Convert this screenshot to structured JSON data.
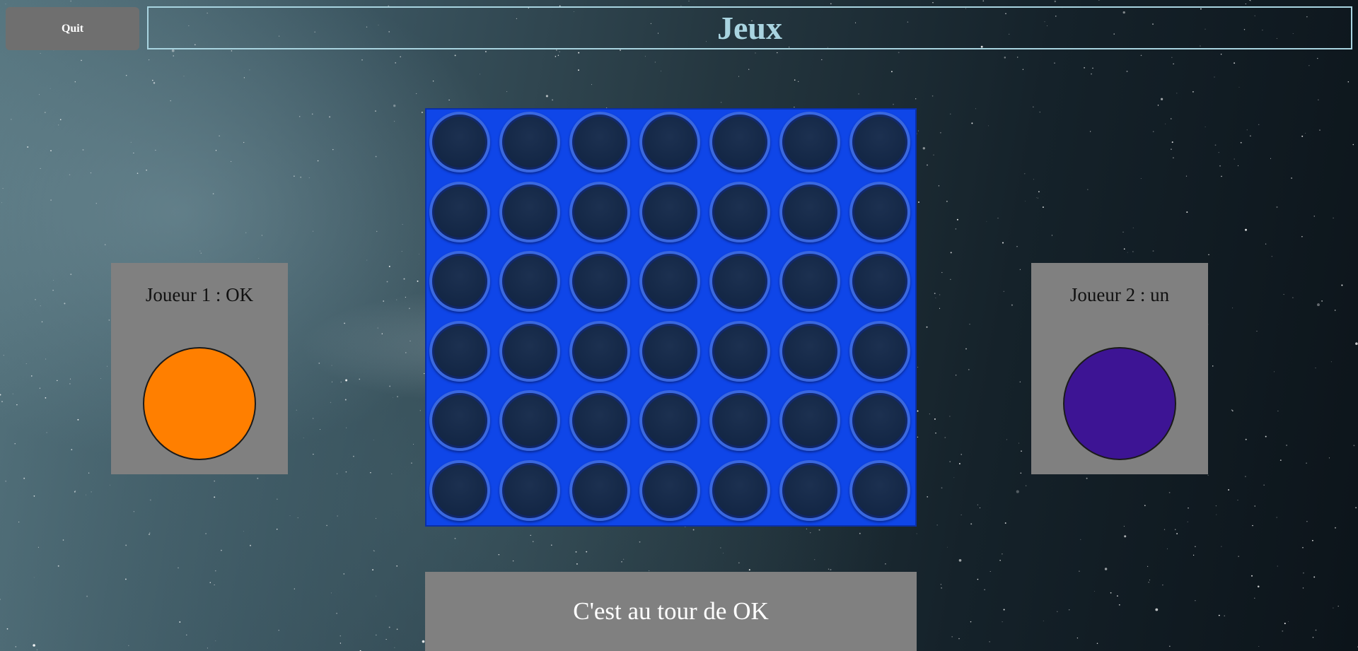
{
  "header": {
    "quit_label": "Quit",
    "title": "Jeux"
  },
  "players": [
    {
      "label": "Joueur 1 : OK",
      "color": "#ff7f00"
    },
    {
      "label": "Joueur 2 : un",
      "color": "#3d1494"
    }
  ],
  "board": {
    "columns": 7,
    "rows": 6,
    "color": "#0f46e8",
    "cells": [
      [
        "",
        "",
        "",
        "",
        "",
        "",
        ""
      ],
      [
        "",
        "",
        "",
        "",
        "",
        "",
        ""
      ],
      [
        "",
        "",
        "",
        "",
        "",
        "",
        ""
      ],
      [
        "",
        "",
        "",
        "",
        "",
        "",
        ""
      ],
      [
        "",
        "",
        "",
        "",
        "",
        "",
        ""
      ],
      [
        "",
        "",
        "",
        "",
        "",
        "",
        ""
      ]
    ]
  },
  "status": {
    "turn_text": "C'est au tour de OK"
  }
}
